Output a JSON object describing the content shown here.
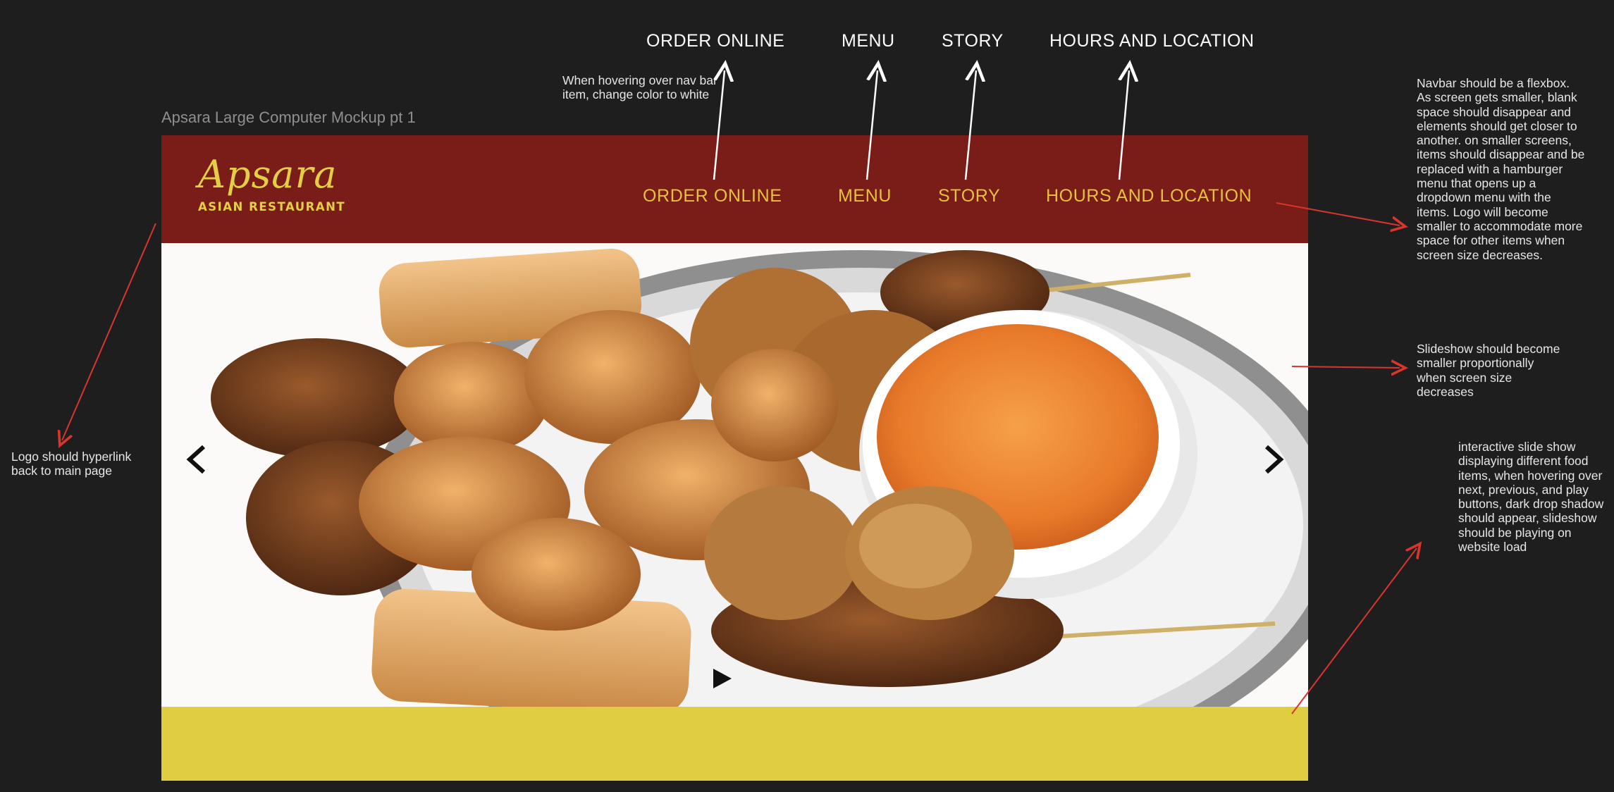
{
  "top_nav": {
    "items": [
      "ORDER ONLINE",
      "MENU",
      "STORY",
      "HOURS AND LOCATION"
    ]
  },
  "annotations": {
    "hover_note": "When hovering over nav bar item, change color to white",
    "logo_note": "Logo should hyperlink back to main page",
    "navbar_note": "Navbar should be a flexbox. As screen gets smaller, blank space should disappear and elements should get closer to another. on smaller screens, items should disappear and be replaced with a hamburger menu that opens up a dropdown menu with the items. Logo will become smaller to accommodate more space for other items when screen size decreases.",
    "slideshow_note": "Slideshow should become smaller proportionally when screen size decreases",
    "interactive_note": "interactive slide show displaying different food items, when hovering over next, previous, and play buttons, dark drop shadow should appear, slideshow should be playing on website load"
  },
  "mockup": {
    "frame_title": "Apsara Large Computer Mockup pt 1",
    "logo": {
      "script": "Apsara",
      "sub": "ASIAN RESTAURANT"
    },
    "nav": [
      "ORDER ONLINE",
      "MENU",
      "STORY",
      "HOURS AND LOCATION"
    ],
    "slideshow": {
      "prev_icon": "chevron-left-icon",
      "next_icon": "chevron-right-icon",
      "play_icon": "play-icon"
    }
  },
  "colors": {
    "background": "#1e1e1e",
    "navbar": "#7a1d18",
    "nav_text": "#e6c13f",
    "logo": "#e3cf46",
    "footer_band": "#e0cd41",
    "annotation_line": "#d9352d"
  }
}
